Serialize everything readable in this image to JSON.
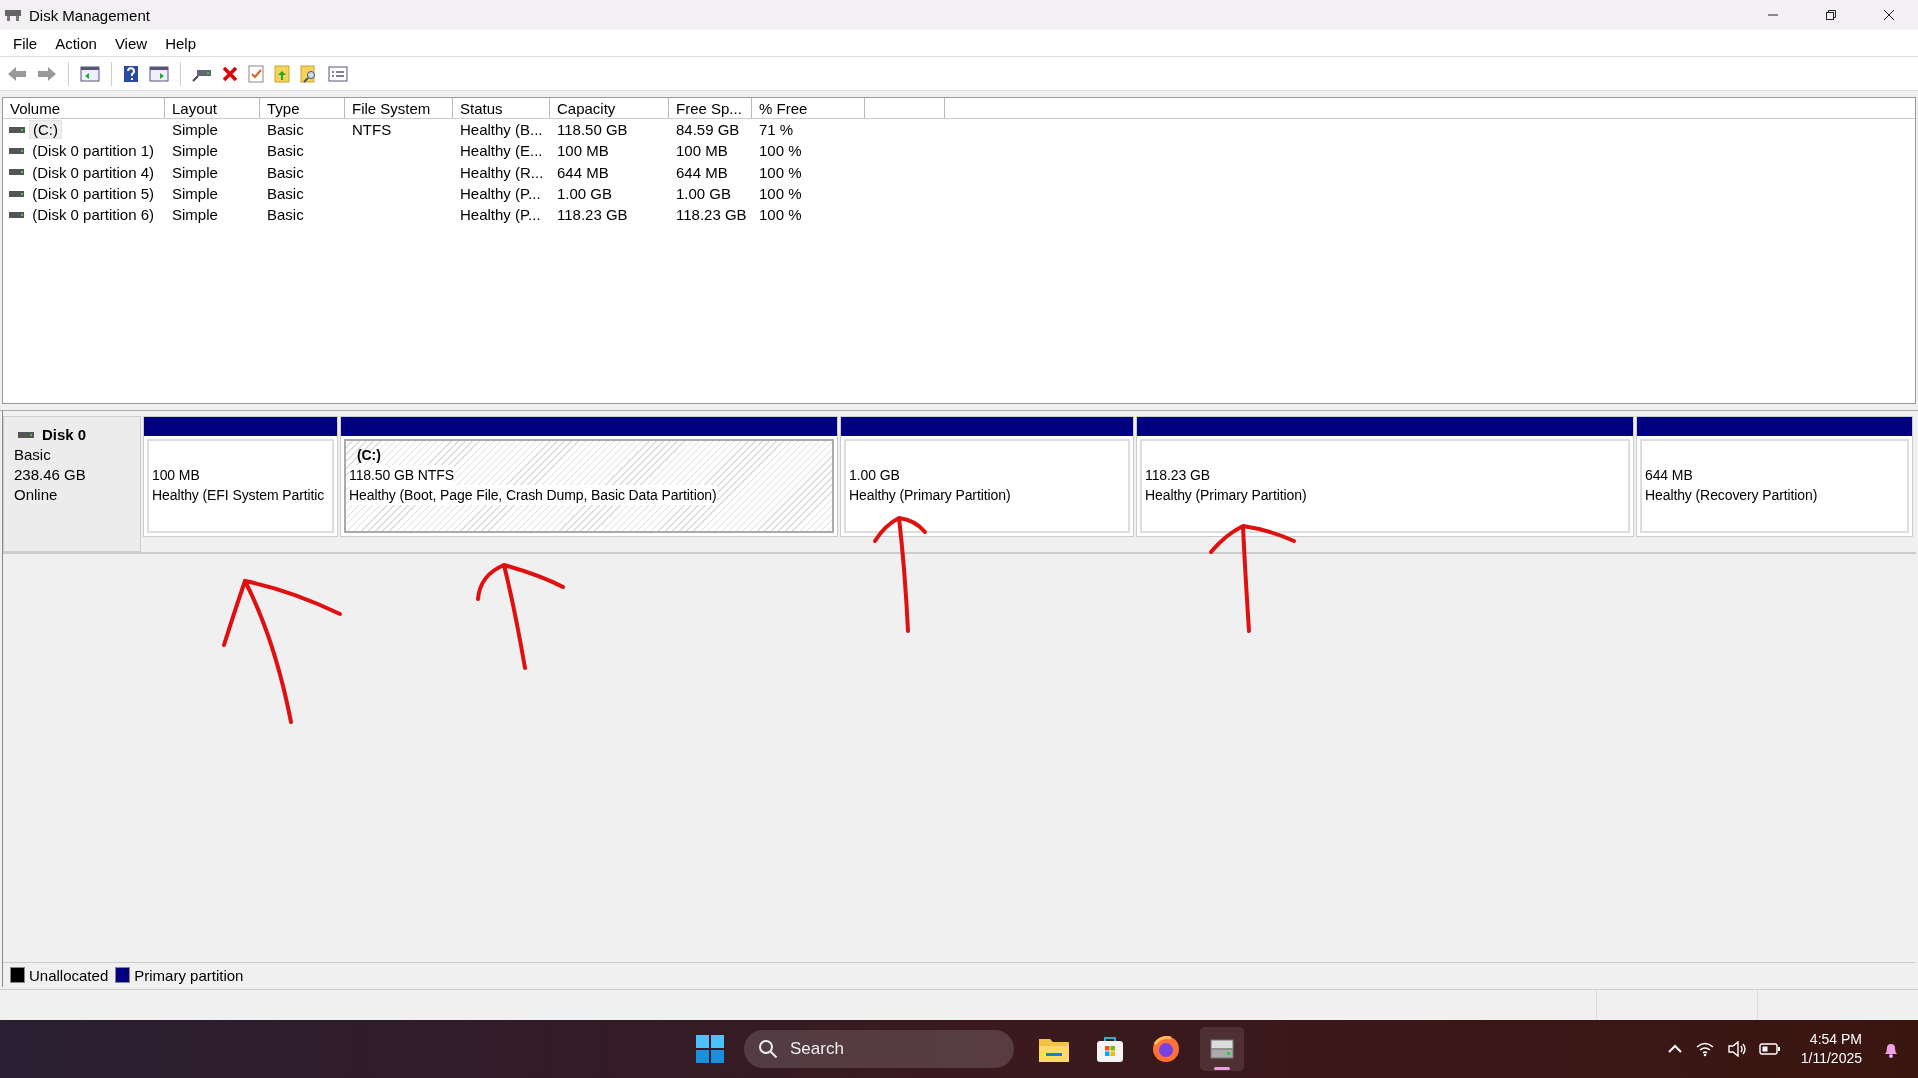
{
  "window": {
    "title": "Disk Management"
  },
  "menu": [
    "File",
    "Action",
    "View",
    "Help"
  ],
  "volumes": {
    "columns": [
      "Volume",
      "Layout",
      "Type",
      "File System",
      "Status",
      "Capacity",
      "Free Sp...",
      "% Free"
    ],
    "rows": [
      {
        "selected": true,
        "cells": [
          "(C:)",
          "Simple",
          "Basic",
          "NTFS",
          "Healthy (B...",
          "118.50 GB",
          "84.59 GB",
          "71 %"
        ]
      },
      {
        "selected": false,
        "cells": [
          "(Disk 0 partition 1)",
          "Simple",
          "Basic",
          "",
          "Healthy (E...",
          "100 MB",
          "100 MB",
          "100 %"
        ]
      },
      {
        "selected": false,
        "cells": [
          "(Disk 0 partition 4)",
          "Simple",
          "Basic",
          "",
          "Healthy (R...",
          "644 MB",
          "644 MB",
          "100 %"
        ]
      },
      {
        "selected": false,
        "cells": [
          "(Disk 0 partition 5)",
          "Simple",
          "Basic",
          "",
          "Healthy (P...",
          "1.00 GB",
          "1.00 GB",
          "100 %"
        ]
      },
      {
        "selected": false,
        "cells": [
          "(Disk 0 partition 6)",
          "Simple",
          "Basic",
          "",
          "Healthy (P...",
          "118.23 GB",
          "118.23 GB",
          "100 %"
        ]
      }
    ]
  },
  "disk": {
    "name": "Disk 0",
    "type": "Basic",
    "size": "238.46 GB",
    "status": "Online",
    "partitions": [
      {
        "selected": false,
        "size": "100 MB",
        "status": "Healthy (EFI System Partitic"
      },
      {
        "selected": true,
        "label": "(C:)",
        "size": "118.50 GB NTFS",
        "status": "Healthy (Boot, Page File, Crash Dump, Basic Data Partition)"
      },
      {
        "selected": false,
        "size": "1.00 GB",
        "status": "Healthy (Primary Partition)"
      },
      {
        "selected": false,
        "size": "118.23 GB",
        "status": "Healthy (Primary Partition)"
      },
      {
        "selected": false,
        "size": "644 MB",
        "status": "Healthy (Recovery Partition)"
      }
    ]
  },
  "legend": [
    {
      "label": "Unallocated",
      "color": "#000000"
    },
    {
      "label": "Primary partition",
      "color": "#000080"
    }
  ],
  "taskbar": {
    "search": {
      "placeholder": "Search"
    },
    "apps": [
      {
        "kind": "files",
        "selected": false
      },
      {
        "kind": "store",
        "selected": false
      },
      {
        "kind": "browser",
        "selected": false
      },
      {
        "kind": "disk",
        "selected": true
      }
    ],
    "time": "4:54 PM",
    "date": "1/11/2025"
  }
}
